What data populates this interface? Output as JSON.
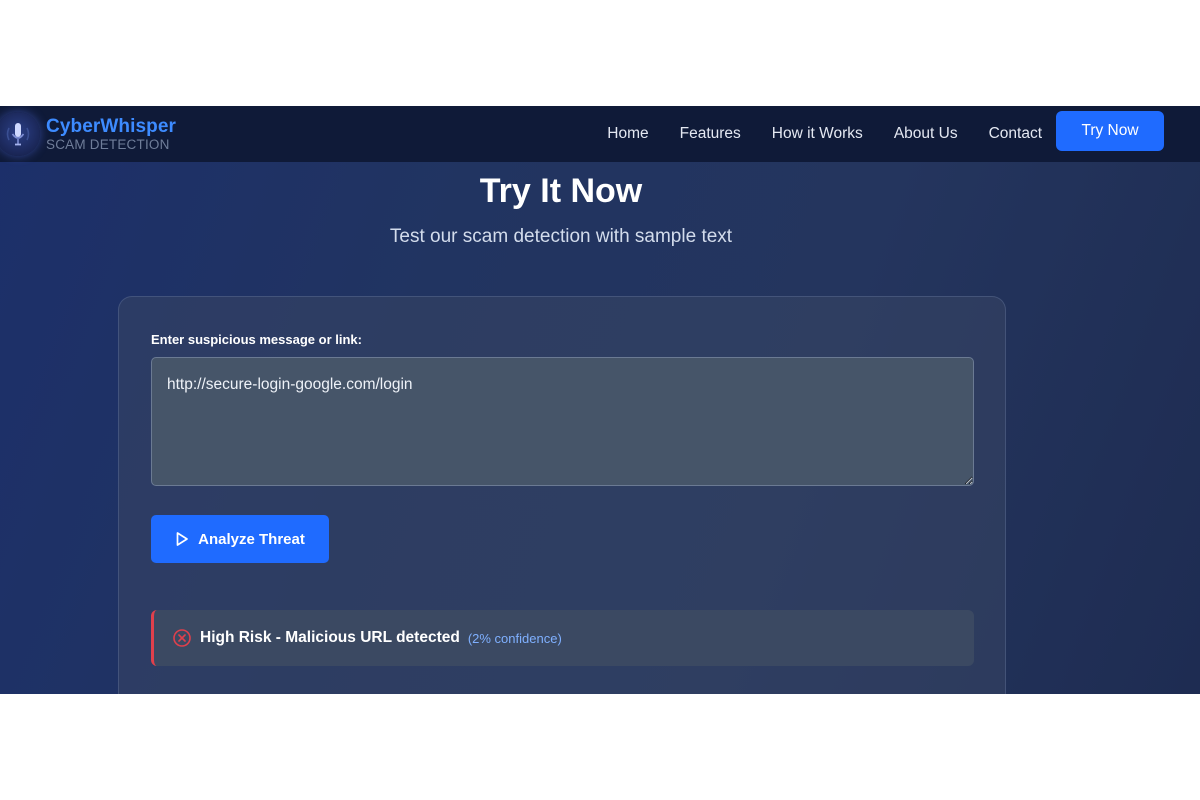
{
  "brand": {
    "name": "CyberWhisper",
    "tagline": "SCAM DETECTION"
  },
  "nav": {
    "links": [
      "Home",
      "Features",
      "How it Works",
      "About Us",
      "Contact"
    ],
    "cta_label": "Try Now"
  },
  "hero": {
    "title": "Try It Now",
    "subtitle": "Test our scam detection with sample text"
  },
  "analyzer": {
    "input_label": "Enter suspicious message or link:",
    "input_value": "http://secure-login-google.com/login",
    "analyze_label": "Analyze Threat",
    "result_text": "High Risk - Malicious URL detected",
    "result_confidence": "(2% confidence)"
  },
  "colors": {
    "accent": "#1f6bff",
    "brand": "#3d8bff",
    "danger": "#e0404c",
    "confidence": "#7fb0ff"
  },
  "icons": {
    "logo": "microphone-icon",
    "analyze": "play-icon",
    "result": "x-circle-icon"
  }
}
